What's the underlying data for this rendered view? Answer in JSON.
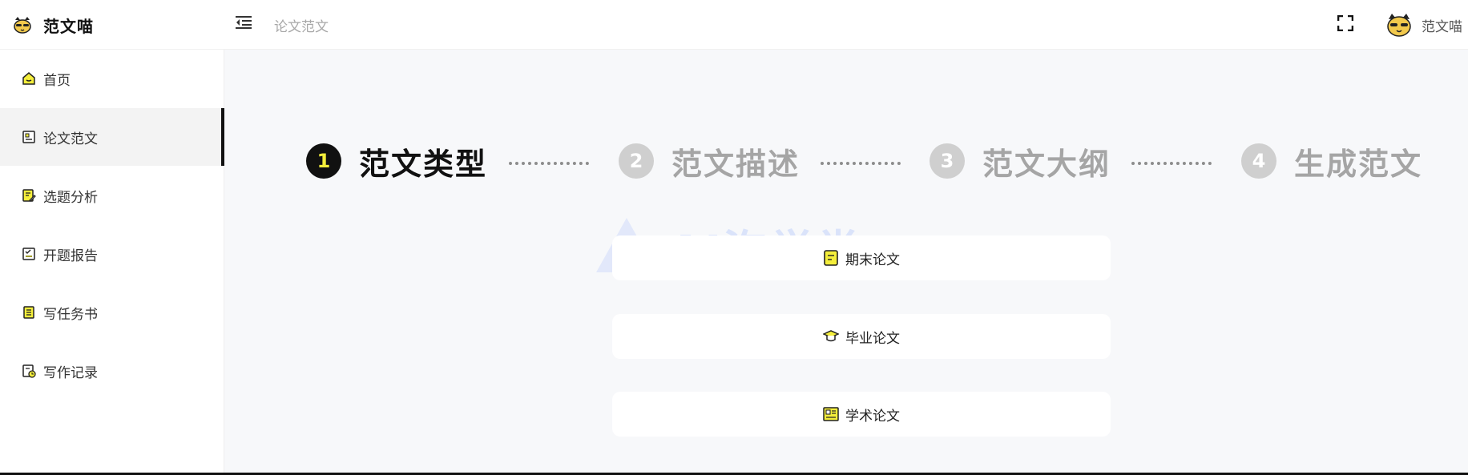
{
  "app": {
    "name": "范文喵"
  },
  "header": {
    "breadcrumb": "论文范文",
    "user_name": "范文喵"
  },
  "sidebar": {
    "items": [
      {
        "label": "首页",
        "icon": "home-icon",
        "active": false
      },
      {
        "label": "论文范文",
        "icon": "document-icon",
        "active": true
      },
      {
        "label": "选题分析",
        "icon": "edit-list-icon",
        "active": false
      },
      {
        "label": "开题报告",
        "icon": "checklist-icon",
        "active": false
      },
      {
        "label": "写任务书",
        "icon": "notebook-icon",
        "active": false
      },
      {
        "label": "写作记录",
        "icon": "history-icon",
        "active": false
      }
    ]
  },
  "steps": [
    {
      "number": "1",
      "label": "范文类型",
      "active": true
    },
    {
      "number": "2",
      "label": "范文描述",
      "active": false
    },
    {
      "number": "3",
      "label": "范文大纲",
      "active": false
    },
    {
      "number": "4",
      "label": "生成范文",
      "active": false
    }
  ],
  "watermark": {
    "text": "AI泡学堂"
  },
  "paper_types": [
    {
      "label": "期末论文",
      "icon": "note-icon"
    },
    {
      "label": "毕业论文",
      "icon": "graduation-cap-icon"
    },
    {
      "label": "学术论文",
      "icon": "newspaper-icon"
    }
  ],
  "colors": {
    "accent": "#111111",
    "highlight_yellow": "#f4ee3b",
    "inactive_step": "#a5a5a5",
    "main_bg": "#f7f8fa"
  }
}
